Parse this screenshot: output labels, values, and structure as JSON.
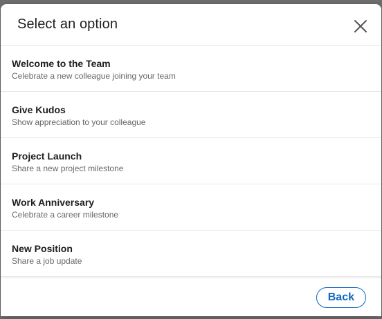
{
  "dialog": {
    "title": "Select an option",
    "close_icon": "close-icon"
  },
  "options": [
    {
      "title": "Welcome to the Team",
      "subtitle": "Celebrate a new colleague joining your team"
    },
    {
      "title": "Give Kudos",
      "subtitle": "Show appreciation to your colleague"
    },
    {
      "title": "Project Launch",
      "subtitle": "Share a new project milestone"
    },
    {
      "title": "Work Anniversary",
      "subtitle": "Celebrate a career milestone"
    },
    {
      "title": "New Position",
      "subtitle": "Share a job update"
    }
  ],
  "footer": {
    "back_label": "Back"
  },
  "colors": {
    "accent": "#0a66c2",
    "title_text": "#1d1d1d",
    "subtitle_text": "#666666",
    "divider": "#e8e8e8"
  }
}
